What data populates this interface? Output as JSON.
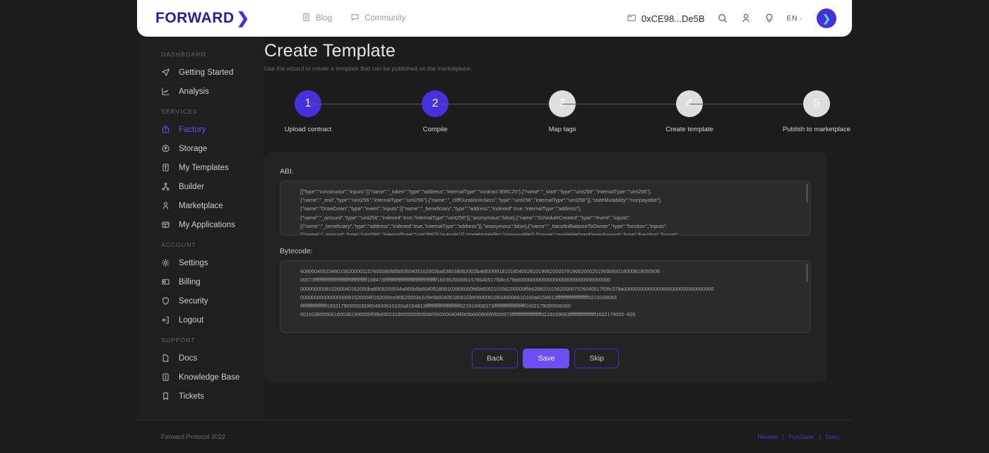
{
  "header": {
    "logo_text": "FORWARD",
    "logo_chevron": "❯",
    "nav": [
      {
        "label": "Blog",
        "icon": "document-icon"
      },
      {
        "label": "Community",
        "icon": "chat-icon"
      }
    ],
    "wallet_address": "0xCE98...De5B",
    "icons": [
      "search-icon",
      "user-icon",
      "lightbulb-icon"
    ],
    "language": "EN",
    "language_caret": "›",
    "avatar_glyph": "❯"
  },
  "sidebar": {
    "sections": [
      {
        "title": "DASHBOARD",
        "items": [
          {
            "label": "Getting Started",
            "icon": "navigation-icon",
            "active": false
          },
          {
            "label": "Analysis",
            "icon": "chart-icon",
            "active": false
          }
        ]
      },
      {
        "title": "SERVICES",
        "items": [
          {
            "label": "Factory",
            "icon": "factory-icon",
            "active": true
          },
          {
            "label": "Storage",
            "icon": "cloud-upload-icon",
            "active": false
          },
          {
            "label": "My Templates",
            "icon": "template-icon",
            "active": false
          },
          {
            "label": "Builder",
            "icon": "nodes-icon",
            "active": false
          },
          {
            "label": "Marketplace",
            "icon": "person-icon",
            "active": false
          },
          {
            "label": "My Applications",
            "icon": "apps-icon",
            "active": false
          }
        ]
      },
      {
        "title": "ACCOUNT",
        "items": [
          {
            "label": "Settings",
            "icon": "gear-icon",
            "active": false
          },
          {
            "label": "Billing",
            "icon": "card-icon",
            "active": false
          },
          {
            "label": "Security",
            "icon": "shield-icon",
            "active": false
          },
          {
            "label": "Logout",
            "icon": "logout-icon",
            "active": false
          }
        ]
      },
      {
        "title": "SUPPORT",
        "items": [
          {
            "label": "Docs",
            "icon": "file-icon",
            "active": false
          },
          {
            "label": "Knowledge Base",
            "icon": "book-icon",
            "active": false
          },
          {
            "label": "Tickets",
            "icon": "ticket-icon",
            "active": false
          }
        ]
      }
    ]
  },
  "main": {
    "title": "Create Template",
    "subtitle": "Use the wizard to create a template that can be published on the marketplace.",
    "steps": [
      {
        "number": "1",
        "label": "Upload contract",
        "state": "done"
      },
      {
        "number": "2",
        "label": "Compile",
        "state": "done"
      },
      {
        "number": "3",
        "label": "Map tags",
        "state": "pending"
      },
      {
        "number": "4",
        "label": "Create template",
        "state": "pending"
      },
      {
        "number": "5",
        "label": "Publish to marketplace",
        "state": "pending"
      }
    ],
    "abi_label": "ABI:",
    "abi_value": "[{\"type\":\"constructor\",\"inputs\":[{\"name\":\"_token\",\"type\":\"address\",\"internalType\":\"contract IERC20\"},{\"name\":\"_start\",\"type\":\"uint256\",\"internalType\":\"uint256\"},\n{\"name\":\"_end\",\"type\":\"uint256\",\"internalType\":\"uint256\"},{\"name\":\"_cliffDurationInSecs\",\"type\":\"uint256\",\"internalType\":\"uint256\"}],\"stateMutability\":\"nonpayable\"},\n{\"name\":\"DrawDown\",\"type\":\"event\",\"inputs\":[{\"name\":\"_beneficiary\",\"type\":\"address\",\"indexed\":true,\"internalType\":\"address\"},\n{\"name\":\"_amount\",\"type\":\"uint256\",\"indexed\":true,\"internalType\":\"uint256\"}],\"anonymous\":false},{\"name\":\"ScheduleCreated\",\"type\":\"event\",\"inputs\":\n[{\"name\":\"_beneficiary\",\"type\":\"address\",\"indexed\":true,\"internalType\":\"address\"}],\"anonymous\":false},{\"name\":\"_transferBalanceToOwner\",\"type\":\"function\",\"inputs\":\n[{\"name\":\"_amount\",\"type\":\"uint256\",\"internalType\":\"uint256\"}],\"outputs\":[],\"stateMutability\":\"nonpayable\"},{\"name\":\"availableDrawDownAmount\",\"type\":\"function\",\"inputs\":",
    "bytecode_label": "Bytecode:",
    "bytecode_value": "60806040523480156200001157600080fd5b5060405162002ba638038062002ba683398181016040528101906200037919062000251565b60016000819055506\n00073ffffffffffffffffffffffffffffffffffffffff168473ffffffffffffffffffffffffffffffffffffffff1603620000b1576040517f08c379a000000000000000000000000000000000\n000000000815260040162000ba8906200034a565b5b604051809103906000fd5b828210156200000f5b6288210156200007576040517f08c379a00000000000000000000000000000000\n00000000000000000815260040162000ce90620003e2c5e5b6040518091039060006108346006610100a8154813ffffffffffffffffffffffff0219169083\nffffffffffffffffffff160217905550303604600610100a8154813ffffffffffffffffffffffffff021916908373ffffffffffffffffffffffff1602179055508260\n0019196555061600381906555f08b6902319055550505060562000404f665b600806f6f600073ffffffffffffffffffffff0219169083ffffffffffffffffffff1602179055~826",
    "buttons": [
      {
        "label": "Back",
        "style": "outline"
      },
      {
        "label": "Save",
        "style": "primary"
      },
      {
        "label": "Skip",
        "style": "outline"
      }
    ]
  },
  "footer": {
    "copyright": "Forward Protocol 2022",
    "links": [
      "Review",
      "Purchase",
      "Docs"
    ],
    "separator": "|"
  },
  "colors": {
    "accent": "#4531dd",
    "accent_light": "#6c4df6",
    "page_bg": "#1c1c1c",
    "sidebar_bg": "#1f1f1f",
    "card_bg": "#222222"
  }
}
